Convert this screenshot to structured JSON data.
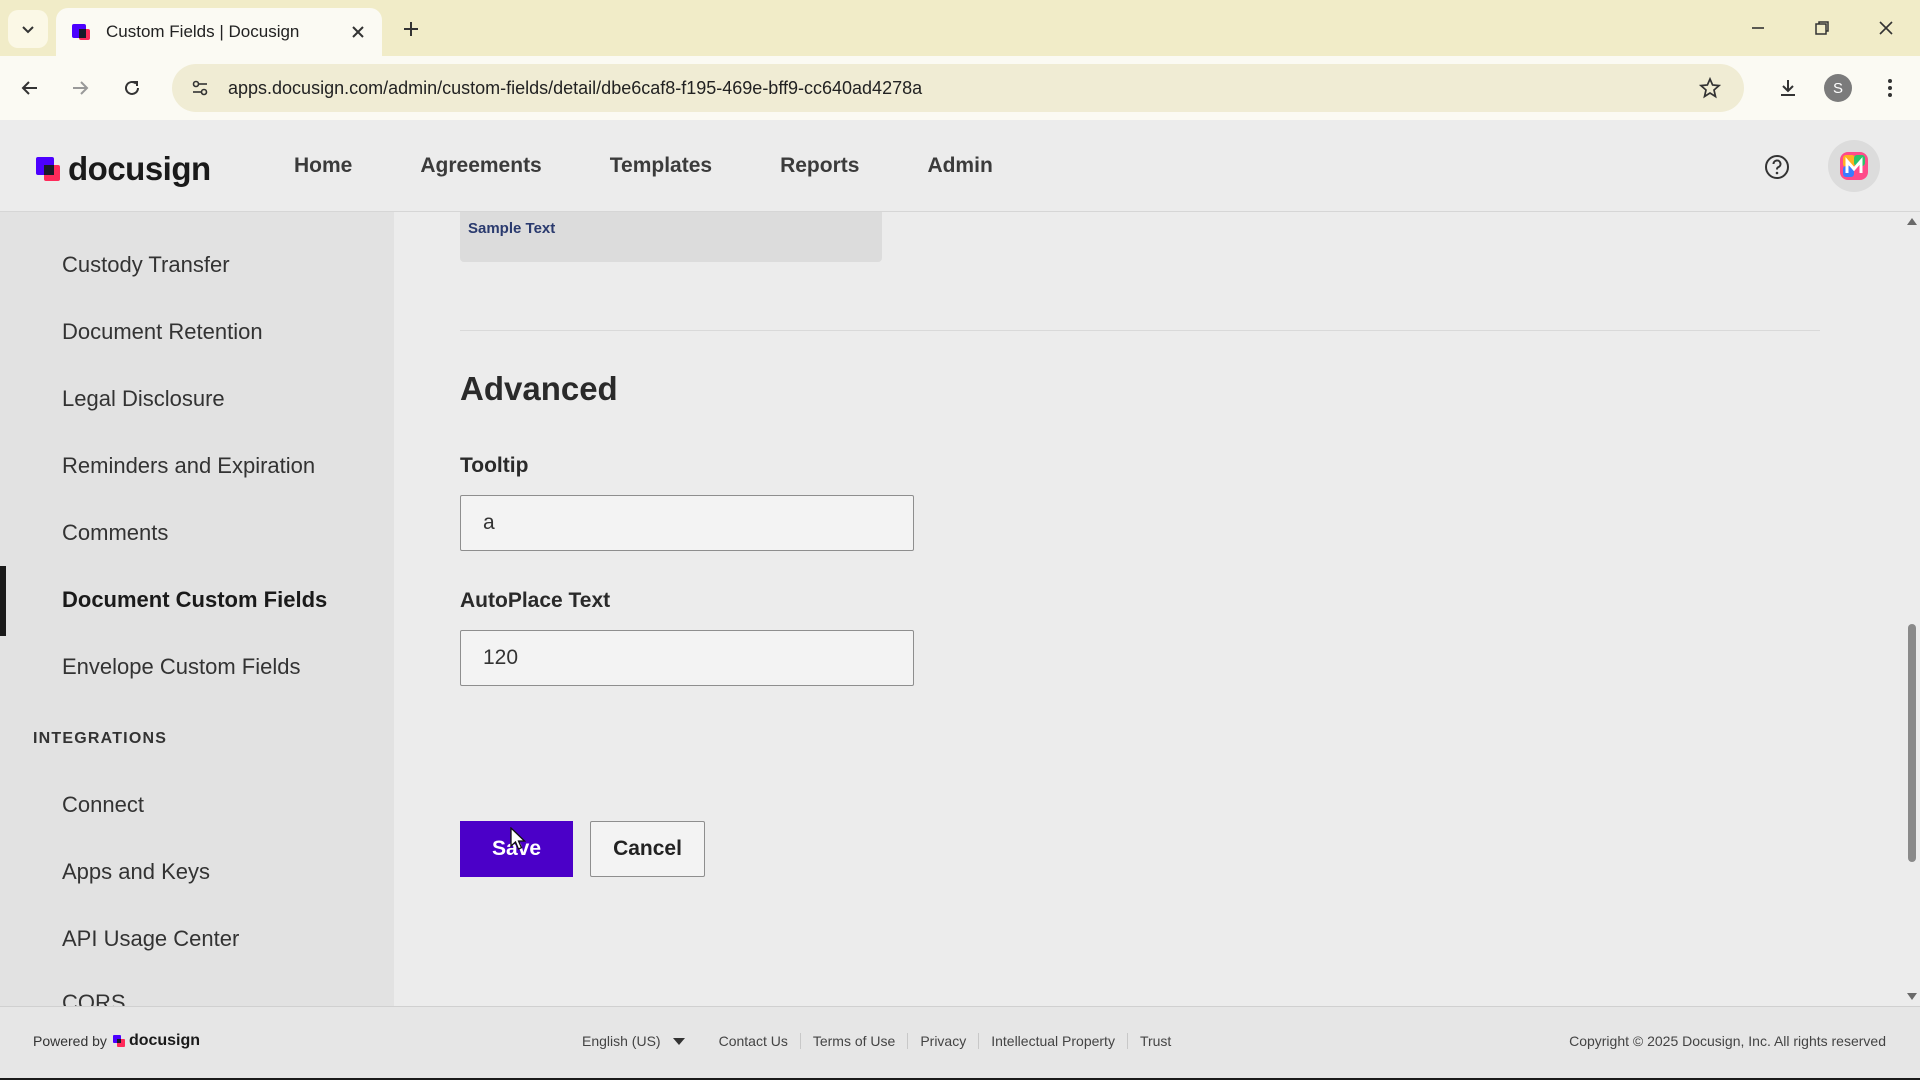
{
  "browser": {
    "tab_title": "Custom Fields | Docusign",
    "url": "apps.docusign.com/admin/custom-fields/detail/dbe6caf8-f195-469e-bff9-cc640ad4278a",
    "profile_initial": "S"
  },
  "header": {
    "brand": "docusign",
    "nav": [
      "Home",
      "Agreements",
      "Templates",
      "Reports",
      "Admin"
    ]
  },
  "sidebar": {
    "items": [
      {
        "label": "Custody Transfer"
      },
      {
        "label": "Document Retention"
      },
      {
        "label": "Legal Disclosure"
      },
      {
        "label": "Reminders and Expiration"
      },
      {
        "label": "Comments"
      },
      {
        "label": "Document Custom Fields",
        "active": true
      },
      {
        "label": "Envelope Custom Fields"
      }
    ],
    "integrations_heading": "INTEGRATIONS",
    "integrations_items": [
      {
        "label": "Connect"
      },
      {
        "label": "Apps and Keys"
      },
      {
        "label": "API Usage Center"
      },
      {
        "label": "CORS"
      }
    ]
  },
  "main": {
    "sample_text": "Sample Text",
    "section_title": "Advanced",
    "tooltip_label": "Tooltip",
    "tooltip_value": "a",
    "autoplace_label": "AutoPlace Text",
    "autoplace_value": "120",
    "save_label": "Save",
    "cancel_label": "Cancel"
  },
  "footer": {
    "powered_by": "Powered by",
    "brand": "docusign",
    "language": "English (US)",
    "links": [
      "Contact Us",
      "Terms of Use",
      "Privacy",
      "Intellectual Property",
      "Trust"
    ],
    "copyright": "Copyright © 2025 Docusign, Inc. All rights reserved"
  },
  "colors": {
    "primary_button": "#4b00c8",
    "brand_mark": "#4c00ff",
    "brand_mark_accent": "#ff2a5a"
  }
}
